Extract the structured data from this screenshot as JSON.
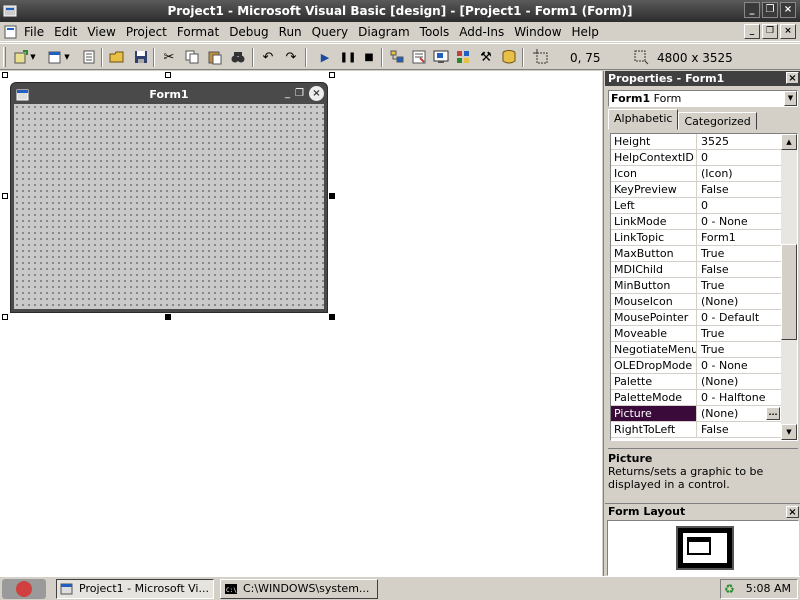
{
  "window": {
    "title": "Project1 - Microsoft Visual Basic [design] - [Project1 - Form1 (Form)]",
    "minimize_glyph": "_",
    "restore_glyph": "❐",
    "close_glyph": "×"
  },
  "menu": {
    "items": [
      "File",
      "Edit",
      "View",
      "Project",
      "Format",
      "Debug",
      "Run",
      "Query",
      "Diagram",
      "Tools",
      "Add-Ins",
      "Window",
      "Help"
    ]
  },
  "toolbar": {
    "position_readout": "0, 75",
    "size_readout": "4800 x 3525"
  },
  "form_designer": {
    "form_caption": "Form1"
  },
  "properties": {
    "title": "Properties - Form1",
    "object_name": "Form1",
    "object_type": "Form",
    "tabs": [
      "Alphabetic",
      "Categorized"
    ],
    "active_tab": "Alphabetic",
    "rows": [
      {
        "name": "Height",
        "value": "3525"
      },
      {
        "name": "HelpContextID",
        "value": "0"
      },
      {
        "name": "Icon",
        "value": "(Icon)"
      },
      {
        "name": "KeyPreview",
        "value": "False"
      },
      {
        "name": "Left",
        "value": "0"
      },
      {
        "name": "LinkMode",
        "value": "0 - None"
      },
      {
        "name": "LinkTopic",
        "value": "Form1"
      },
      {
        "name": "MaxButton",
        "value": "True"
      },
      {
        "name": "MDIChild",
        "value": "False"
      },
      {
        "name": "MinButton",
        "value": "True"
      },
      {
        "name": "MouseIcon",
        "value": "(None)"
      },
      {
        "name": "MousePointer",
        "value": "0 - Default"
      },
      {
        "name": "Moveable",
        "value": "True"
      },
      {
        "name": "NegotiateMenus",
        "value": "True"
      },
      {
        "name": "OLEDropMode",
        "value": "0 - None"
      },
      {
        "name": "Palette",
        "value": "(None)"
      },
      {
        "name": "PaletteMode",
        "value": "0 - Halftone"
      },
      {
        "name": "Picture",
        "value": "(None)"
      },
      {
        "name": "RightToLeft",
        "value": "False"
      }
    ],
    "selected_property": "Picture",
    "ellipsis_label": "...",
    "description_title": "Picture",
    "description_text": "Returns/sets a graphic to be displayed in a control."
  },
  "form_layout": {
    "title": "Form Layout"
  },
  "taskbar": {
    "tasks": [
      {
        "label": "Project1 - Microsoft Vi...",
        "active": true
      },
      {
        "label": "C:\\WINDOWS\\system...",
        "active": false
      }
    ],
    "clock": "5:08 AM"
  },
  "colors": {
    "selected_row": "#3a0b3a",
    "title_bar": "#3c3c3c",
    "panel_face": "#d4d0c8"
  }
}
